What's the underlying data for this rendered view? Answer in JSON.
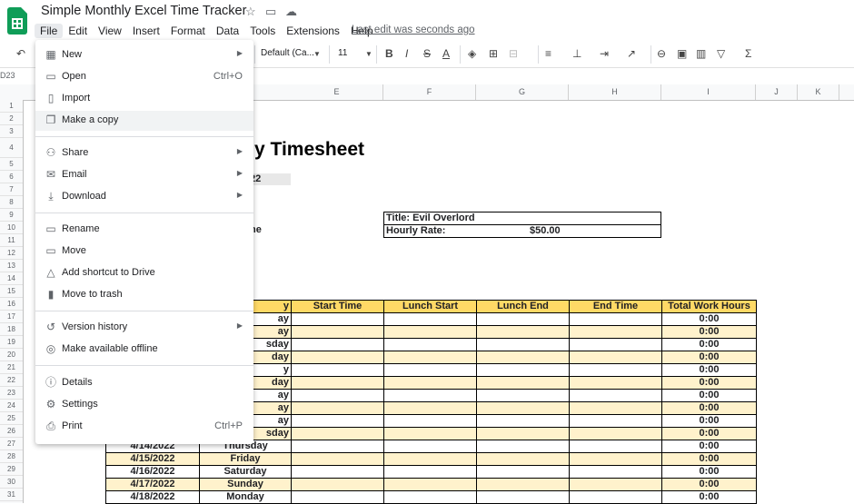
{
  "header": {
    "title": "Simple Monthly Excel Time Tracker",
    "last_edit": "Last edit was seconds ago",
    "menu": [
      "File",
      "Edit",
      "View",
      "Insert",
      "Format",
      "Data",
      "Tools",
      "Extensions",
      "Help"
    ]
  },
  "toolbar": {
    "font": "Default (Ca...",
    "font_size": "11"
  },
  "formula": {
    "cell_ref": "D23"
  },
  "columns": [
    "E",
    "F",
    "G",
    "H",
    "I",
    "J",
    "K"
  ],
  "rows": [
    "1",
    "2",
    "3",
    "4",
    "5",
    "6",
    "7",
    "8",
    "9",
    "10",
    "11",
    "12",
    "13",
    "14",
    "15",
    "16",
    "17",
    "18",
    "19",
    "20",
    "21",
    "22",
    "23",
    "24",
    "25",
    "26",
    "27",
    "28",
    "29",
    "30",
    "31"
  ],
  "sheet": {
    "title_fragment": "y Timesheet",
    "date_fragment": "22",
    "title_label": "Title: Evil Overlord",
    "name_fragment": "ne",
    "rate_label": "Hourly Rate:",
    "rate_value": "$50.00",
    "header_fragment": "y",
    "col_headers": [
      "Start Time",
      "Lunch Start",
      "Lunch End",
      "End Time",
      "Total Work Hours"
    ],
    "partial_rows": [
      {
        "day": "ay",
        "total": "0:00"
      },
      {
        "day": "ay",
        "total": "0:00"
      },
      {
        "day": "sday",
        "total": "0:00"
      },
      {
        "day": "day",
        "total": "0:00"
      },
      {
        "day": "y",
        "total": "0:00"
      },
      {
        "day": "day",
        "total": "0:00"
      },
      {
        "day": "ay",
        "total": "0:00"
      },
      {
        "day": "ay",
        "total": "0:00"
      },
      {
        "day": "ay",
        "total": "0:00"
      },
      {
        "day": "sday",
        "total": "0:00"
      }
    ],
    "full_rows": [
      {
        "date": "4/14/2022",
        "day": "Thursday",
        "total": "0:00"
      },
      {
        "date": "4/15/2022",
        "day": "Friday",
        "total": "0:00"
      },
      {
        "date": "4/16/2022",
        "day": "Saturday",
        "total": "0:00"
      },
      {
        "date": "4/17/2022",
        "day": "Sunday",
        "total": "0:00"
      },
      {
        "date": "4/18/2022",
        "day": "Monday",
        "total": "0:00"
      }
    ]
  },
  "file_menu": {
    "items": [
      {
        "label": "New",
        "icon": "new-sheet-icon",
        "glyph": "▦",
        "shortcut": "",
        "arrow": true
      },
      {
        "label": "Open",
        "icon": "folder-open-icon",
        "glyph": "▭",
        "shortcut": "Ctrl+O",
        "arrow": false
      },
      {
        "label": "Import",
        "icon": "import-icon",
        "glyph": "▯",
        "shortcut": "",
        "arrow": false
      },
      {
        "label": "Make a copy",
        "icon": "copy-icon",
        "glyph": "❐",
        "shortcut": "",
        "arrow": false
      },
      {
        "label": "Share",
        "icon": "share-person-icon",
        "glyph": "⚇",
        "shortcut": "",
        "arrow": true
      },
      {
        "label": "Email",
        "icon": "email-icon",
        "glyph": "✉",
        "shortcut": "",
        "arrow": true
      },
      {
        "label": "Download",
        "icon": "download-icon",
        "glyph": "⤓",
        "shortcut": "",
        "arrow": true
      },
      {
        "label": "Rename",
        "icon": "rename-icon",
        "glyph": "▭",
        "shortcut": "",
        "arrow": false
      },
      {
        "label": "Move",
        "icon": "move-folder-icon",
        "glyph": "▭",
        "shortcut": "",
        "arrow": false
      },
      {
        "label": "Add shortcut to Drive",
        "icon": "drive-shortcut-icon",
        "glyph": "△",
        "shortcut": "",
        "arrow": false
      },
      {
        "label": "Move to trash",
        "icon": "trash-icon",
        "glyph": "▮",
        "shortcut": "",
        "arrow": false
      },
      {
        "label": "Version history",
        "icon": "history-icon",
        "glyph": "↺",
        "shortcut": "",
        "arrow": true
      },
      {
        "label": "Make available offline",
        "icon": "offline-icon",
        "glyph": "◎",
        "shortcut": "",
        "arrow": false
      },
      {
        "label": "Details",
        "icon": "info-icon",
        "glyph": "ⓘ",
        "shortcut": "",
        "arrow": false
      },
      {
        "label": "Settings",
        "icon": "settings-gear-icon",
        "glyph": "⚙",
        "shortcut": "",
        "arrow": false
      },
      {
        "label": "Print",
        "icon": "print-icon",
        "glyph": "⎙",
        "shortcut": "Ctrl+P",
        "arrow": false
      }
    ]
  },
  "colors": {
    "header_fill": "#ffd966",
    "alt_fill": "#fff2cc",
    "sheets_green": "#0f9d58"
  }
}
